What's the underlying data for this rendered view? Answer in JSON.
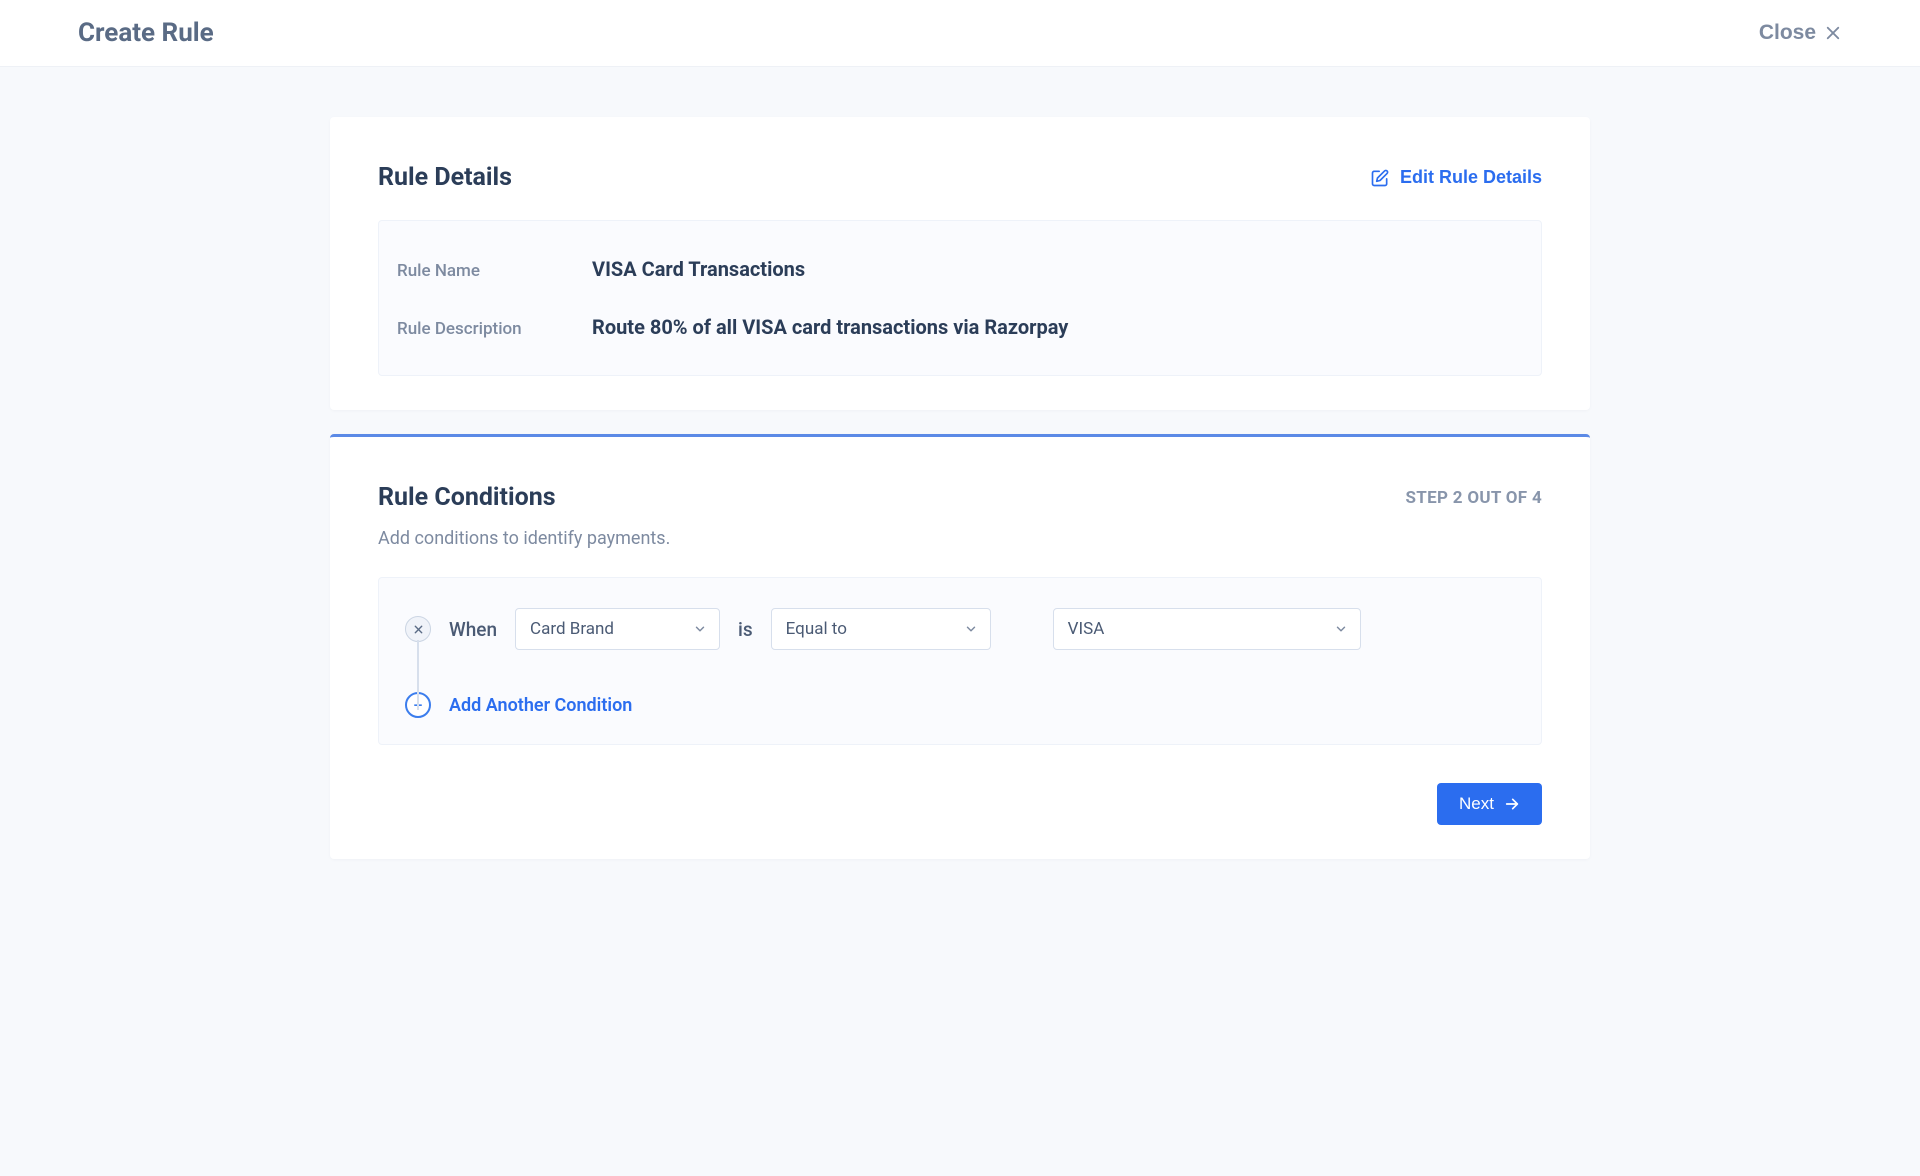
{
  "header": {
    "title": "Create Rule",
    "close_label": "Close"
  },
  "rule_details": {
    "section_title": "Rule Details",
    "edit_label": "Edit Rule Details",
    "name_label": "Rule Name",
    "name_value": "VISA Card Transactions",
    "desc_label": "Rule Description",
    "desc_value": "Route 80% of all VISA card transactions via Razorpay"
  },
  "rule_conditions": {
    "section_title": "Rule Conditions",
    "step_label": "STEP 2 OUT OF 4",
    "subhead": "Add conditions to identify payments.",
    "when_label": "When",
    "is_label": "is",
    "field_value": "Card Brand",
    "operator_value": "Equal to",
    "value_value": "VISA",
    "add_another_label": "Add Another Condition",
    "next_label": "Next"
  }
}
